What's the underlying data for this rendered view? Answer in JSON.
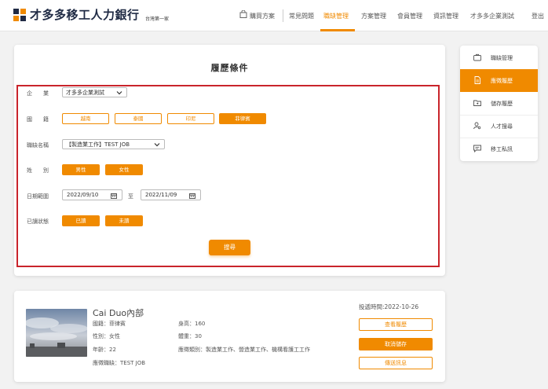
{
  "header": {
    "logo_text": "才多多移工人力銀行",
    "logo_sub": "台灣第一家",
    "nav": {
      "buy": "購買方案",
      "faq": "常見問題",
      "jobs": "職缺管理",
      "plans": "方案管理",
      "members": "會員管理",
      "info": "資訊管理",
      "company": "才多多企業測試",
      "logout": "登出"
    }
  },
  "filter": {
    "title": "履歷條件",
    "company_label": "企　　業",
    "company_value": "才多多企業測試",
    "nationality_label": "國　　籍",
    "nationalities": [
      "越南",
      "泰國",
      "印尼",
      "菲律賓"
    ],
    "job_label": "職缺名稱",
    "job_value": "【製造業工作】TEST JOB",
    "gender_label": "姓　　別",
    "genders": [
      "男性",
      "女性"
    ],
    "date_label": "日期範圍",
    "date_from": "2022/09/10",
    "date_to_label": "至",
    "date_to": "2022/11/09",
    "read_label": "已讀狀態",
    "read_states": [
      "已讀",
      "未讀"
    ],
    "search_label": "搜尋"
  },
  "sidebar": {
    "items": [
      "職缺管理",
      "應徵履歷",
      "儲存履歷",
      "人才搜尋",
      "移工私訊"
    ]
  },
  "candidate": {
    "name": "Cai Duo內部",
    "nationality": "國籍：菲律賓",
    "gender": "性別：女性",
    "age": "年齡：22",
    "applied_job": "應徵職缺：TEST JOB",
    "height": "身高：160",
    "weight": "體重：30",
    "job_types": "應徵類別：製造業工作、營造業工作、機構看護工工作",
    "submit_time": "投遞時間:2022-10-26",
    "view_label": "查看履歷",
    "unsave_label": "取消儲存",
    "message_label": "傳送訊息"
  },
  "colors": {
    "accent": "#f08a00",
    "highlight_border": "#c9242b",
    "logo": "#1f2a44"
  }
}
